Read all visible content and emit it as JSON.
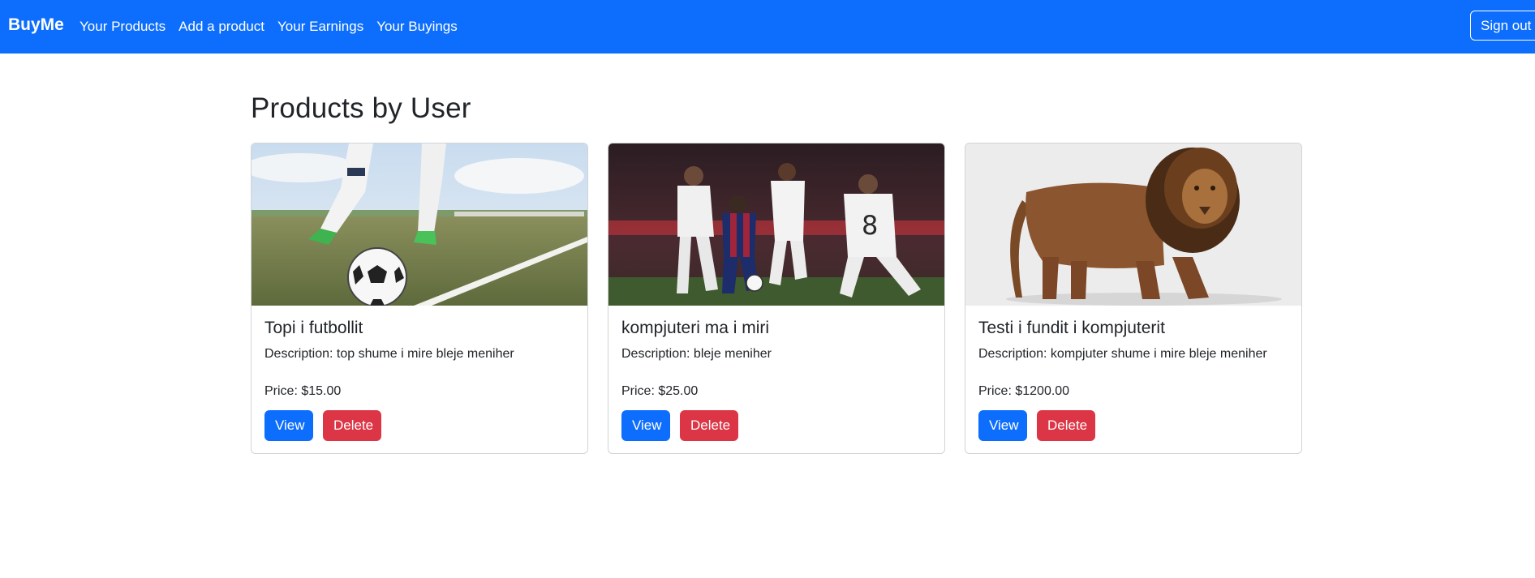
{
  "nav": {
    "brand": "BuyMe",
    "links": [
      "Your Products",
      "Add a product",
      "Your Earnings",
      "Your Buyings"
    ],
    "signout": "Sign out",
    "color": "#0d6efd"
  },
  "page": {
    "title": "Products by User"
  },
  "products": [
    {
      "title": "Topi i futbollit",
      "description": "Description: top shume i mire bleje meniher",
      "price": "Price: $15.00",
      "image_icon": "soccer-ball-photo"
    },
    {
      "title": "kompjuteri ma i miri",
      "description": "Description: bleje meniher",
      "price": "Price: $25.00",
      "image_icon": "soccer-players-photo"
    },
    {
      "title": "Testi i fundit i kompjuterit",
      "description": "Description: kompjuter shume i mire bleje meniher",
      "price": "Price: $1200.00",
      "image_icon": "lion-photo"
    }
  ],
  "buttons": {
    "view": "View",
    "delete": "Delete"
  },
  "colors": {
    "primary": "#0d6efd",
    "danger": "#dc3545"
  }
}
